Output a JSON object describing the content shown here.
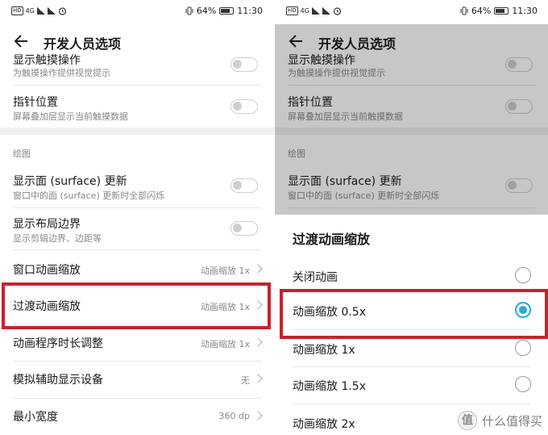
{
  "status_bar": {
    "network": "HD",
    "network_sup": "4G",
    "battery": "64%",
    "time": "11:30"
  },
  "header": {
    "title": "开发人员选项"
  },
  "left_screen": {
    "partial_item": {
      "title": "显示触摸操作",
      "subtitle": "为触摸操作提供视觉提示"
    },
    "pointer_item": {
      "title": "指针位置",
      "subtitle": "屏幕叠加层显示当前触摸数据"
    },
    "section_drawing": "绘图",
    "surface_item": {
      "title": "显示面 (surface) 更新",
      "subtitle": "窗口中的面 (surface) 更新时全部闪烁"
    },
    "layout_item": {
      "title": "显示布局边界",
      "subtitle": "显示剪辑边界、边距等"
    },
    "window_scale": {
      "title": "窗口动画缩放",
      "value": "动画缩放 1x"
    },
    "transition_scale": {
      "title": "过渡动画缩放",
      "value": "动画缩放 1x"
    },
    "animator_scale": {
      "title": "动画程序时长调整",
      "value": "动画缩放 1x"
    },
    "simulate_display": {
      "title": "模拟辅助显示设备",
      "value": "无"
    },
    "min_width": {
      "title": "最小宽度",
      "value": "360 dp"
    }
  },
  "right_screen": {
    "sheet_title": "过渡动画缩放",
    "options": [
      {
        "label": "关闭动画",
        "selected": false
      },
      {
        "label": "动画缩放 0.5x",
        "selected": true
      },
      {
        "label": "动画缩放 1x",
        "selected": false
      },
      {
        "label": "动画缩放 1.5x",
        "selected": false
      },
      {
        "label": "动画缩放 2x",
        "selected": false
      }
    ]
  },
  "watermark": {
    "badge": "值",
    "text": "什么值得买"
  },
  "colors": {
    "highlight": "#c7222f",
    "accent": "#2aa8d8"
  }
}
